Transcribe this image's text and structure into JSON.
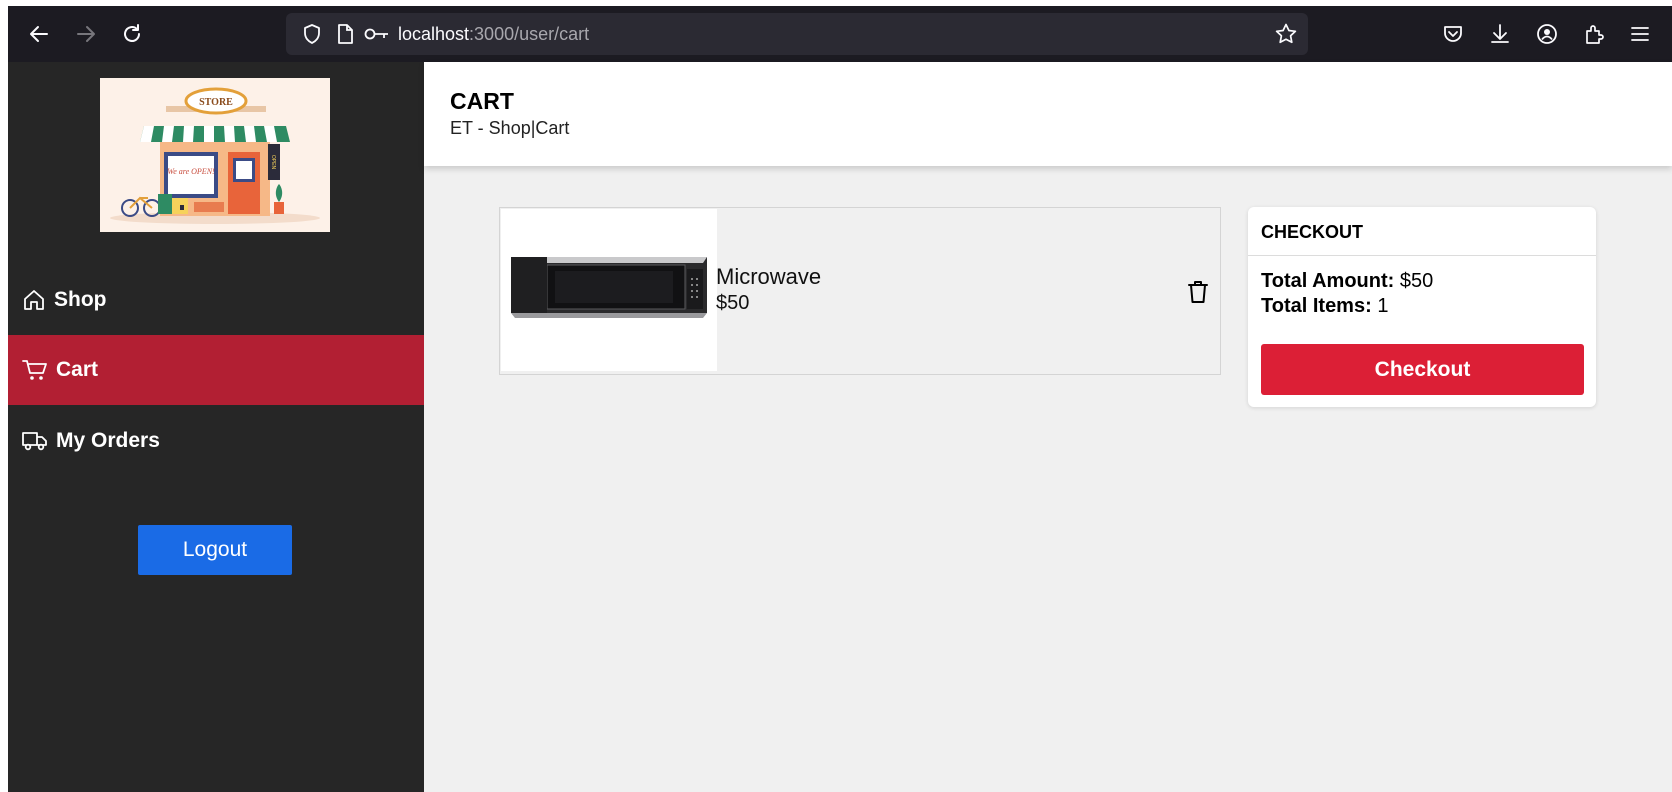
{
  "browser": {
    "url_host": "localhost",
    "url_path": ":3000/user/cart"
  },
  "sidebar": {
    "logo": {
      "sign_text": "STORE",
      "window_text": "We are OPEN!",
      "side_sign": "OPEN"
    },
    "items": [
      {
        "label": "Shop",
        "icon": "home-icon",
        "active": false
      },
      {
        "label": "Cart",
        "icon": "cart-icon",
        "active": true
      },
      {
        "label": "My Orders",
        "icon": "truck-icon",
        "active": false
      }
    ],
    "logout_label": "Logout"
  },
  "header": {
    "title": "CART",
    "breadcrumb": "ET - Shop|Cart"
  },
  "cart": {
    "items": [
      {
        "name": "Microwave",
        "price": "$50"
      }
    ]
  },
  "checkout": {
    "title": "CHECKOUT",
    "total_amount_label": "Total Amount:",
    "total_amount": "$50",
    "total_items_label": "Total Items:",
    "total_items": "1",
    "button_label": "Checkout"
  },
  "colors": {
    "sidebar_bg": "#262626",
    "active_nav": "#b21f33",
    "logout_button": "#1a6be6",
    "checkout_button": "#dc1f36"
  }
}
